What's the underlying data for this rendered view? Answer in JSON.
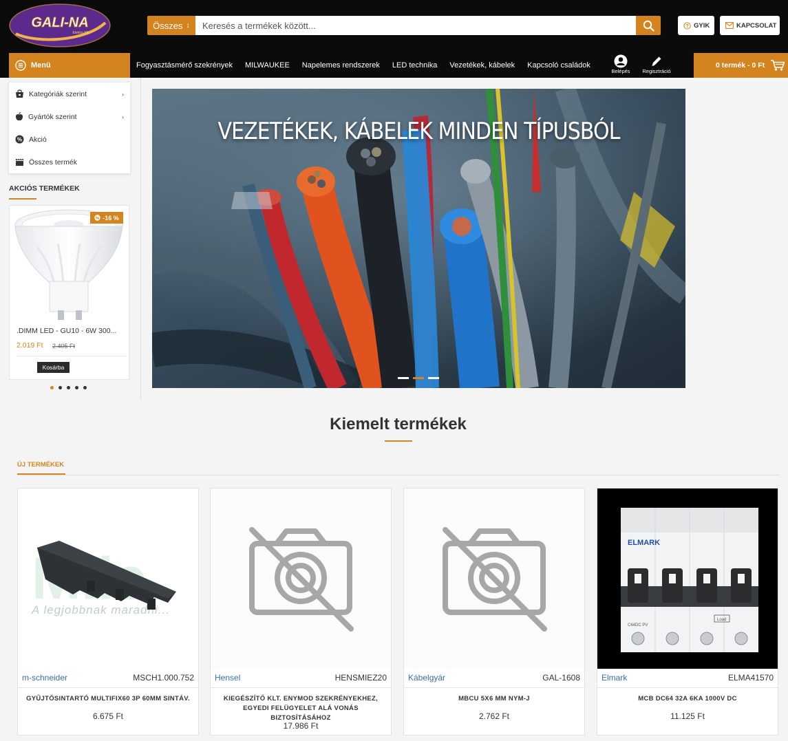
{
  "header": {
    "logo_text": "GALI-NA",
    "logo_sub": "Elektro Kft",
    "search_category": "Összes",
    "search_placeholder": "Keresés a termékek között...",
    "faq_label": "GYIK",
    "contact_label": "KAPCSOLAT"
  },
  "nav": {
    "menu_label": "Menü",
    "links": [
      "Fogyasztásmérő szekrények",
      "MILWAUKEE",
      "Napelemes rendszerek",
      "LED technika",
      "Vezetékek, kábelek",
      "Kapcsoló családok"
    ],
    "login_label": "Belépés",
    "register_label": "Regisztráció",
    "cart_label": "0 termék - 0 Ft"
  },
  "sidebar": {
    "menu_items": [
      {
        "label": "Kategóriák szerint",
        "icon": "shop-icon",
        "has_submenu": true
      },
      {
        "label": "Gyártók szerint",
        "icon": "apple-icon",
        "has_submenu": true
      },
      {
        "label": "Akció",
        "icon": "percent-icon",
        "has_submenu": false
      },
      {
        "label": "Összes termék",
        "icon": "clapper-icon",
        "has_submenu": false
      }
    ],
    "sale_title": "AKCIÓS TERMÉKEK",
    "sale_product": {
      "badge": "-16 %",
      "name": ".DIMM LED - GU10 - 6W 300...",
      "price": "2.019 Ft",
      "old_price": "2.405 Ft",
      "cart_label": "Kosárba"
    },
    "carousel_dots": 5,
    "carousel_active": 0
  },
  "hero": {
    "title": "VEZETÉKEK, KÁBELEK MINDEN TÍPUSBÓL",
    "slides": 3,
    "active_slide": 1
  },
  "featured": {
    "title": "Kiemelt termékek",
    "tab_label": "ÚJ TERMÉKEK",
    "products": [
      {
        "brand": "m-schneider",
        "sku": "MSCH1.000.752",
        "name": "GYŰJTŐSINTARTÓ MULTIFIX60 3P 60MM SINTÁV.",
        "price": "6.675 Ft",
        "watermark": "Mile",
        "watermark_sub": "A legjobbnak maradni..."
      },
      {
        "brand": "Hensel",
        "sku": "HENSMIEZ20",
        "name": "KIEGÉSZÍTŐ KLT. ENYMOD SZEKRÉNYEKHEZ, EGYEDI FELÜGYELET ALÁ VONÁS BIZTOSÍTÁSÁHOZ",
        "price": "17.986 Ft"
      },
      {
        "brand": "Kábelgyár",
        "sku": "GAL-1608",
        "name": "MBCU 5X6 MM NYM-J",
        "price": "2.762 Ft"
      },
      {
        "brand": "Elmark",
        "sku": "ELMA41570",
        "name": "MCB DC64 32A 6KA 1000V DC",
        "price": "11.125 Ft",
        "device_brand": "ELMARK",
        "device_model": "C64DC PV",
        "device_label": "Load"
      }
    ]
  },
  "colors": {
    "accent": "#d4841f",
    "header_bg": "#0b0b0b",
    "link": "#3a6ea5"
  }
}
